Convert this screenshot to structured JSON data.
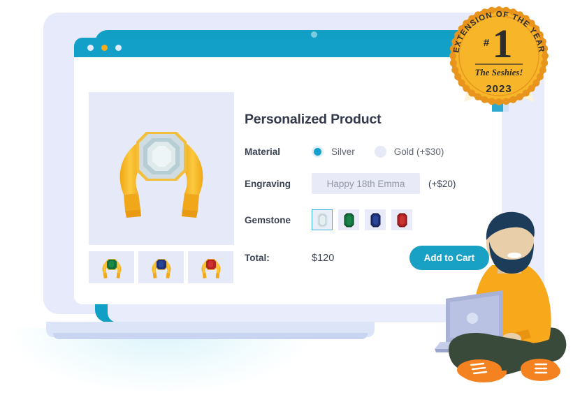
{
  "page": {
    "background": "#ffffff",
    "accent": "#12a0c8",
    "gold": "#f5b118"
  },
  "laptop": {
    "name": "laptop-illustration",
    "bezel_color": "#129fc6",
    "body_color": "#e7eafb",
    "webcam": "webcam-dot"
  },
  "browser": {
    "titlebar": {
      "color": "#12a0c8",
      "dots": [
        {
          "name": "window-dot-close",
          "color": "#e3e9fb"
        },
        {
          "name": "window-dot-minimize",
          "color": "#f8ab17"
        },
        {
          "name": "window-dot-maximize",
          "color": "#e3e9fb"
        }
      ]
    }
  },
  "gallery": {
    "hero": {
      "name": "product-hero-image",
      "alt": "gold-cuff-bracelet-with-diamond-gemstone",
      "metal_color": "#f5b423",
      "gem_color": "#cfdee2"
    },
    "thumbnails": [
      {
        "name": "thumbnail-emerald",
        "alt": "gold-cuff-bracelet-emerald",
        "gem_color": "#14713a"
      },
      {
        "name": "thumbnail-sapphire",
        "alt": "gold-cuff-bracelet-sapphire",
        "gem_color": "#1b2f72"
      },
      {
        "name": "thumbnail-ruby",
        "alt": "gold-cuff-bracelet-ruby",
        "gem_color": "#b02121"
      }
    ]
  },
  "product": {
    "title": "Personalized Product",
    "material": {
      "label": "Material",
      "options": [
        {
          "label": "Silver",
          "selected": true
        },
        {
          "label": "Gold (+$30)",
          "selected": false
        }
      ]
    },
    "engraving": {
      "label": "Engraving",
      "value": "",
      "placeholder": "Happy 18th Emma",
      "surcharge": "(+$20)"
    },
    "gemstone": {
      "label": "Gemstone",
      "options": [
        {
          "name": "gemstone-diamond",
          "color": "#d7e2e6",
          "dark": "#a8bcc4",
          "selected": true
        },
        {
          "name": "gemstone-emerald",
          "color": "#12703a",
          "dark": "#0b4d26",
          "selected": false
        },
        {
          "name": "gemstone-sapphire",
          "color": "#1d3278",
          "dark": "#121f4f",
          "selected": false
        },
        {
          "name": "gemstone-ruby",
          "color": "#b32222",
          "dark": "#7e1515",
          "selected": false
        }
      ]
    },
    "total": {
      "label": "Total:",
      "value": "$120"
    },
    "cart_button": "Add to Cart"
  },
  "badge": {
    "name": "award-badge",
    "arc_text": "EXTENSION OF THE YEAR",
    "hash": "#",
    "rank": "1",
    "brand": "The Seshies!",
    "year": "2023",
    "fill": "#f7b52a",
    "rim": "#e8941d"
  },
  "person": {
    "name": "person-with-laptop-illustration",
    "sweater_color": "#f7a81b",
    "pants_color": "#3a4a3a",
    "hair_color": "#1c3c5a",
    "shoe_color": "#f58220",
    "skin_color": "#e8cfa9"
  }
}
